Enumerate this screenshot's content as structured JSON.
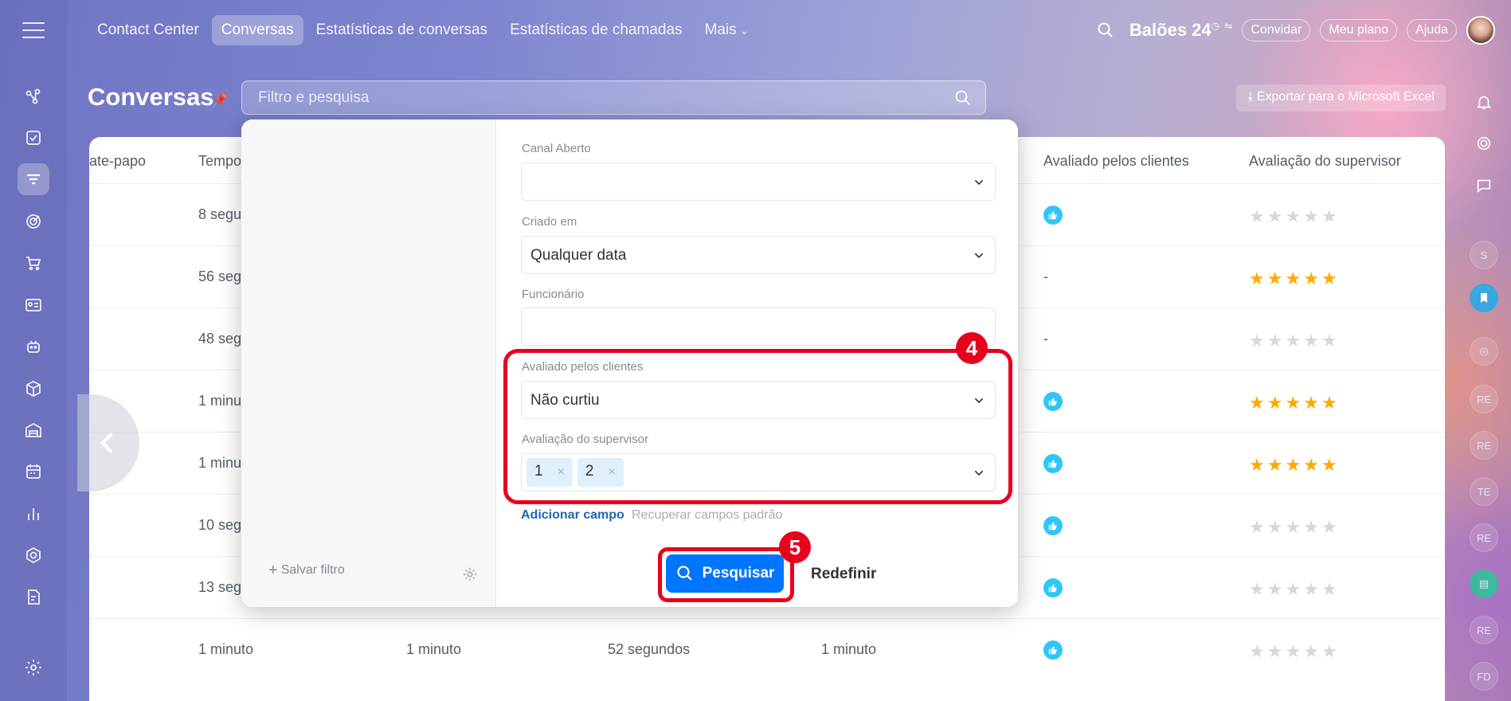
{
  "topnav": {
    "items": [
      "Contact Center",
      "Conversas",
      "Estatísticas de conversas",
      "Estatísticas de chamadas",
      "Mais"
    ],
    "active": 1
  },
  "header": {
    "brand": "Balões 24",
    "invite": "Convidar",
    "plan": "Meu plano",
    "help": "Ajuda"
  },
  "page": {
    "title": "Conversas",
    "search_placeholder": "Filtro e pesquisa",
    "export_label": "Exportar para o Microsoft Excel"
  },
  "table": {
    "columns": [
      "ate-papo",
      "Tempo",
      "Avaliado pelos clientes",
      "Avaliação do supervisor"
    ],
    "rows": [
      {
        "tempo": "8 segu",
        "c3": "",
        "c4": "",
        "c5": "",
        "like": true,
        "stars": 0
      },
      {
        "tempo": "56 segu",
        "c3": "",
        "c4": "",
        "c5": "",
        "like": false,
        "stars": 5
      },
      {
        "tempo": "48 segu",
        "c3": "",
        "c4": "",
        "c5": "",
        "like": false,
        "stars": 0
      },
      {
        "tempo": "1 minu",
        "c3": "",
        "c4": "",
        "c5": "",
        "like": true,
        "stars": 5
      },
      {
        "tempo": "1 minu",
        "c3": "",
        "c4": "",
        "c5": "",
        "like": true,
        "stars": 5
      },
      {
        "tempo": "10 segu",
        "c3": "",
        "c4": "",
        "c5": "",
        "like": true,
        "stars": 0
      },
      {
        "tempo": "13 segu",
        "c3": "",
        "c4": "",
        "c5": "",
        "like": true,
        "stars": 0
      },
      {
        "tempo": "1 minuto",
        "c3": "1 minuto",
        "c4": "52 segundos",
        "c5": "1 minuto",
        "like": true,
        "stars": 0
      }
    ],
    "dash": "-"
  },
  "filter": {
    "fields": {
      "canal_label": "Canal Aberto",
      "canal_value": "",
      "criado_label": "Criado em",
      "criado_value": "Qualquer data",
      "func_label": "Funcionário",
      "func_value": "",
      "avaliado_label": "Avaliado pelos clientes",
      "avaliado_value": "Não curtiu",
      "supervisor_label": "Avaliação do supervisor",
      "supervisor_tags": [
        "1",
        "2"
      ]
    },
    "add_field": "Adicionar campo",
    "restore_fields": "Recuperar campos padrão",
    "save_filter": "Salvar filtro",
    "search_button": "Pesquisar",
    "reset_button": "Redefinir"
  },
  "annotations": {
    "badge_4": "4",
    "badge_5": "5"
  },
  "right_rail": {
    "initials": [
      "S",
      "RE",
      "RE",
      "TE",
      "RE",
      "RE",
      "FD"
    ]
  },
  "colors": {
    "accent": "#0075ff",
    "highlight": "#e8001c",
    "star_on": "#ffa900",
    "like": "#2fc6f6"
  }
}
